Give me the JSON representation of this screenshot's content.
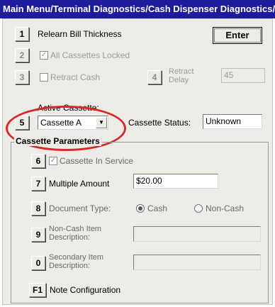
{
  "window": {
    "title": "Main Menu/Terminal Diagnostics/Cash Dispenser Diagnostics/Ca.."
  },
  "enter_button": {
    "label": "Enter"
  },
  "rows": {
    "relearn": {
      "num": "1",
      "label": "Relearn Bill Thickness"
    },
    "all_locked": {
      "num": "2",
      "label": "All Cassettes Locked",
      "checked": true
    },
    "retract_cash": {
      "num": "3",
      "label": "Retract Cash",
      "checked": false
    },
    "retract_delay": {
      "num": "4",
      "label_line1": "Retract",
      "label_line2": "Delay",
      "value": "45"
    },
    "active_cassette": {
      "num": "5",
      "label": "Active Cassette:",
      "selected": "Cassette A"
    },
    "cassette_status": {
      "label": "Cassette Status:",
      "value": "Unknown"
    }
  },
  "group": {
    "title": "Cassette Parameters",
    "in_service": {
      "num": "6",
      "label": "Cassette In Service",
      "checked": true
    },
    "multiple_amount": {
      "num": "7",
      "label": "Multiple Amount",
      "value": "$20.00"
    },
    "document_type": {
      "num": "8",
      "label": "Document Type:",
      "option_cash": "Cash",
      "option_noncash": "Non-Cash",
      "selected": "Cash"
    },
    "noncash_desc": {
      "num": "9",
      "label_line1": "Non-Cash Item",
      "label_line2": "Description:",
      "value": ""
    },
    "secondary_desc": {
      "num": "0",
      "label_line1": "Secondary Item",
      "label_line2": "Description:",
      "value": ""
    },
    "note_config": {
      "num": "F1",
      "label": "Note Configuration"
    }
  },
  "annotation": {
    "color": "#d62a2a"
  }
}
